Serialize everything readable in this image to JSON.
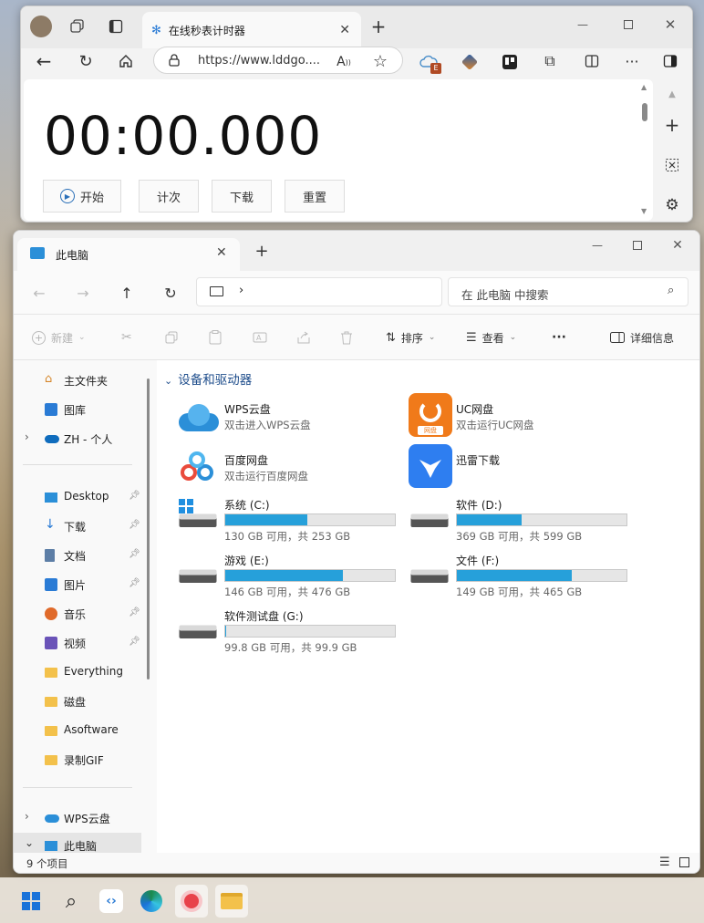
{
  "browser": {
    "tab_title": "在线秒表计时器",
    "address": "https://www.lddgo....",
    "timer_display": "00:00.000",
    "buttons": {
      "start": "开始",
      "lap": "计次",
      "download": "下载",
      "reset": "重置"
    },
    "ext_badge": "E"
  },
  "explorer": {
    "tab_title": "此电脑",
    "search_placeholder": "在 此电脑 中搜索",
    "commands": {
      "new": "新建",
      "sort": "排序",
      "view": "查看",
      "more": "···",
      "details": "详细信息"
    },
    "group_title": "设备和驱动器",
    "nav": [
      {
        "label": "主文件夹",
        "icon": "home-icon"
      },
      {
        "label": "图库",
        "icon": "gallery-icon"
      },
      {
        "label": "ZH - 个人",
        "icon": "onedrive-icon"
      },
      {
        "label": "Desktop",
        "icon": "desktop-icon",
        "pinned": true
      },
      {
        "label": "下载",
        "icon": "download-icon",
        "pinned": true
      },
      {
        "label": "文档",
        "icon": "document-icon",
        "pinned": true
      },
      {
        "label": "图片",
        "icon": "picture-icon",
        "pinned": true
      },
      {
        "label": "音乐",
        "icon": "music-icon",
        "pinned": true
      },
      {
        "label": "视频",
        "icon": "video-icon",
        "pinned": true
      },
      {
        "label": "Everything",
        "icon": "folder-icon"
      },
      {
        "label": "磁盘",
        "icon": "folder-icon"
      },
      {
        "label": "Asoftware",
        "icon": "folder-icon"
      },
      {
        "label": "录制GIF",
        "icon": "folder-icon"
      },
      {
        "label": "WPS云盘",
        "icon": "cloud-icon"
      },
      {
        "label": "此电脑",
        "icon": "pc-icon"
      }
    ],
    "apps": [
      {
        "name": "WPS云盘",
        "desc": "双击进入WPS云盘"
      },
      {
        "name": "UC网盘",
        "desc": "双击运行UC网盘",
        "badge": "网盘"
      },
      {
        "name": "百度网盘",
        "desc": "双击运行百度网盘"
      },
      {
        "name": "迅雷下载",
        "desc": ""
      }
    ],
    "drives": [
      {
        "name": "系统 (C:)",
        "stats": "130 GB 可用，共 253 GB",
        "used_fraction": 0.486
      },
      {
        "name": "软件 (D:)",
        "stats": "369 GB 可用，共 599 GB",
        "used_fraction": 0.384
      },
      {
        "name": "游戏 (E:)",
        "stats": "146 GB 可用，共 476 GB",
        "used_fraction": 0.693
      },
      {
        "name": "文件 (F:)",
        "stats": "149 GB 可用，共 465 GB",
        "used_fraction": 0.68
      },
      {
        "name": "软件测试盘 (G:)",
        "stats": "99.8 GB 可用，共 99.9 GB",
        "used_fraction": 0.001
      }
    ],
    "status": "9 个项目"
  },
  "colors": {
    "accent": "#26a0da",
    "edge_blue": "#0078d4"
  }
}
